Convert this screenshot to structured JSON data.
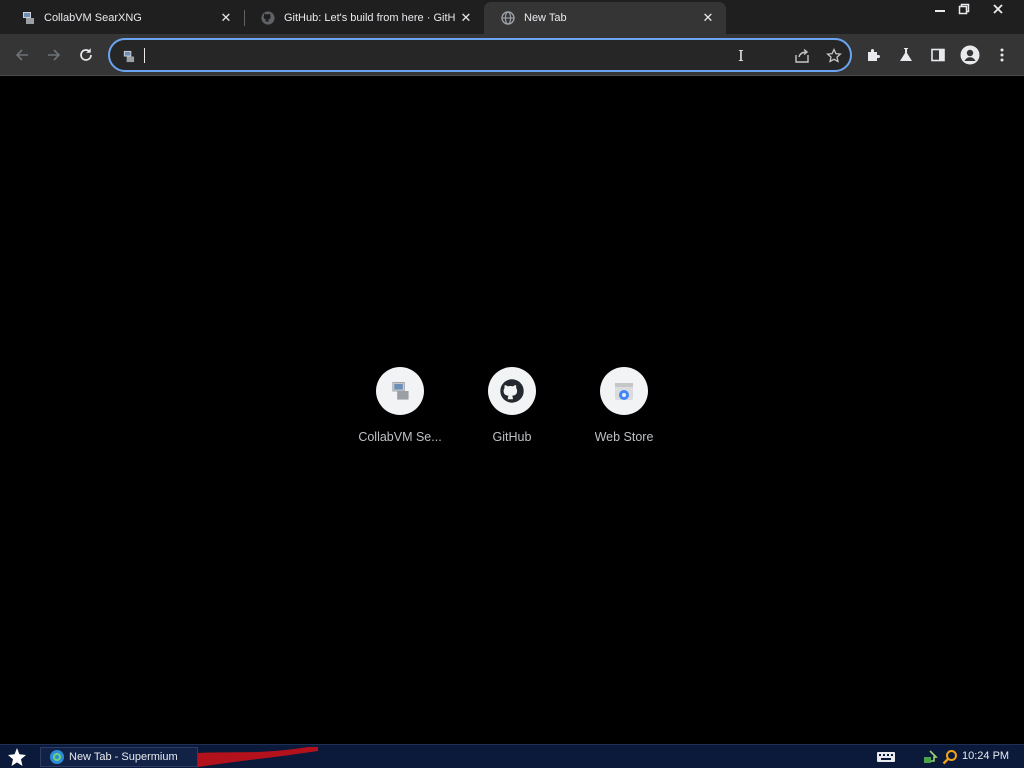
{
  "browser": {
    "tabs": [
      {
        "title": "CollabVM SearXNG",
        "favicon": "collabvm-icon",
        "active": false
      },
      {
        "title": "GitHub: Let's build from here · GitHub",
        "favicon": "github-icon",
        "active": false
      },
      {
        "title": "New Tab",
        "favicon": "globe-icon",
        "active": true
      }
    ],
    "tab_close_glyph": "✕",
    "omnibox": {
      "value": "",
      "placeholder": ""
    }
  },
  "shortcuts": [
    {
      "label": "CollabVM Se...",
      "icon": "collabvm-icon"
    },
    {
      "label": "GitHub",
      "icon": "github-icon"
    },
    {
      "label": "Web Store",
      "icon": "web-store-icon"
    }
  ],
  "taskbar": {
    "task": "New Tab - Supermium",
    "clock": "10:24 PM"
  },
  "colors": {
    "tabstrip_bg": "#1f1f1f",
    "toolbar_bg": "#353535",
    "accent_focus": "#6ba4f0",
    "page_bg": "#000000",
    "taskbar_bg": "#0b1a3a"
  }
}
